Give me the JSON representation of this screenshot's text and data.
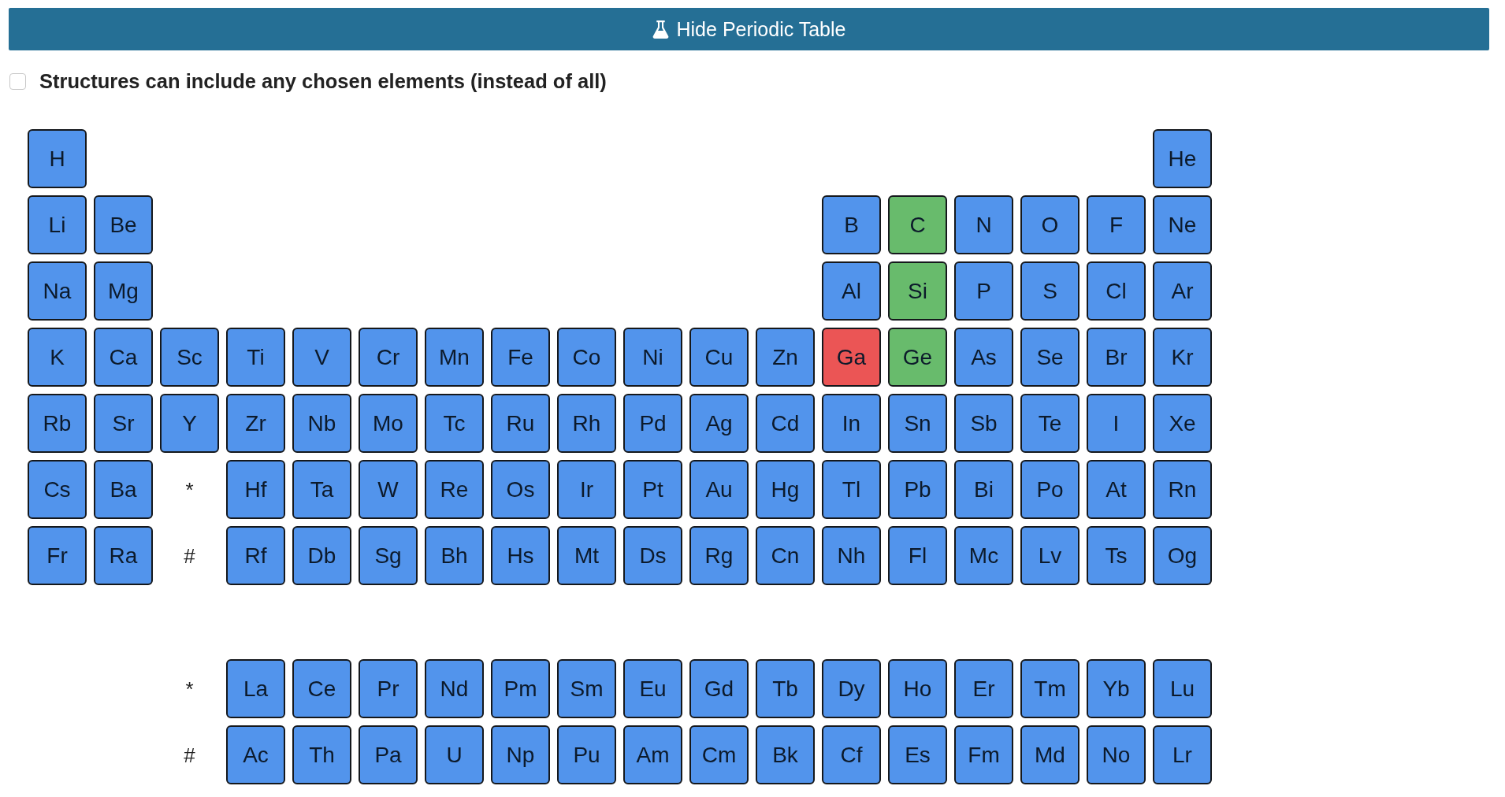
{
  "toggle_button": {
    "label": "Hide Periodic Table"
  },
  "option": {
    "label": "Structures can include any chosen elements (instead of all)",
    "checked": false
  },
  "periodic_table": {
    "main_rows": [
      {
        "cells": [
          {
            "kind": "element",
            "symbol": "H",
            "color": "#5294ec"
          },
          {
            "kind": "blank"
          },
          {
            "kind": "blank"
          },
          {
            "kind": "blank"
          },
          {
            "kind": "blank"
          },
          {
            "kind": "blank"
          },
          {
            "kind": "blank"
          },
          {
            "kind": "blank"
          },
          {
            "kind": "blank"
          },
          {
            "kind": "blank"
          },
          {
            "kind": "blank"
          },
          {
            "kind": "blank"
          },
          {
            "kind": "blank"
          },
          {
            "kind": "blank"
          },
          {
            "kind": "blank"
          },
          {
            "kind": "blank"
          },
          {
            "kind": "blank"
          },
          {
            "kind": "element",
            "symbol": "He",
            "color": "#5294ec"
          }
        ]
      },
      {
        "cells": [
          {
            "kind": "element",
            "symbol": "Li",
            "color": "#5294ec"
          },
          {
            "kind": "element",
            "symbol": "Be",
            "color": "#5294ec"
          },
          {
            "kind": "blank"
          },
          {
            "kind": "blank"
          },
          {
            "kind": "blank"
          },
          {
            "kind": "blank"
          },
          {
            "kind": "blank"
          },
          {
            "kind": "blank"
          },
          {
            "kind": "blank"
          },
          {
            "kind": "blank"
          },
          {
            "kind": "blank"
          },
          {
            "kind": "blank"
          },
          {
            "kind": "element",
            "symbol": "B",
            "color": "#5294ec"
          },
          {
            "kind": "element",
            "symbol": "C",
            "color": "#68bb6c"
          },
          {
            "kind": "element",
            "symbol": "N",
            "color": "#5294ec"
          },
          {
            "kind": "element",
            "symbol": "O",
            "color": "#5294ec"
          },
          {
            "kind": "element",
            "symbol": "F",
            "color": "#5294ec"
          },
          {
            "kind": "element",
            "symbol": "Ne",
            "color": "#5294ec"
          }
        ]
      },
      {
        "cells": [
          {
            "kind": "element",
            "symbol": "Na",
            "color": "#5294ec"
          },
          {
            "kind": "element",
            "symbol": "Mg",
            "color": "#5294ec"
          },
          {
            "kind": "blank"
          },
          {
            "kind": "blank"
          },
          {
            "kind": "blank"
          },
          {
            "kind": "blank"
          },
          {
            "kind": "blank"
          },
          {
            "kind": "blank"
          },
          {
            "kind": "blank"
          },
          {
            "kind": "blank"
          },
          {
            "kind": "blank"
          },
          {
            "kind": "blank"
          },
          {
            "kind": "element",
            "symbol": "Al",
            "color": "#5294ec"
          },
          {
            "kind": "element",
            "symbol": "Si",
            "color": "#68bb6c"
          },
          {
            "kind": "element",
            "symbol": "P",
            "color": "#5294ec"
          },
          {
            "kind": "element",
            "symbol": "S",
            "color": "#5294ec"
          },
          {
            "kind": "element",
            "symbol": "Cl",
            "color": "#5294ec"
          },
          {
            "kind": "element",
            "symbol": "Ar",
            "color": "#5294ec"
          }
        ]
      },
      {
        "cells": [
          {
            "kind": "element",
            "symbol": "K",
            "color": "#5294ec"
          },
          {
            "kind": "element",
            "symbol": "Ca",
            "color": "#5294ec"
          },
          {
            "kind": "element",
            "symbol": "Sc",
            "color": "#5294ec"
          },
          {
            "kind": "element",
            "symbol": "Ti",
            "color": "#5294ec"
          },
          {
            "kind": "element",
            "symbol": "V",
            "color": "#5294ec"
          },
          {
            "kind": "element",
            "symbol": "Cr",
            "color": "#5294ec"
          },
          {
            "kind": "element",
            "symbol": "Mn",
            "color": "#5294ec"
          },
          {
            "kind": "element",
            "symbol": "Fe",
            "color": "#5294ec"
          },
          {
            "kind": "element",
            "symbol": "Co",
            "color": "#5294ec"
          },
          {
            "kind": "element",
            "symbol": "Ni",
            "color": "#5294ec"
          },
          {
            "kind": "element",
            "symbol": "Cu",
            "color": "#5294ec"
          },
          {
            "kind": "element",
            "symbol": "Zn",
            "color": "#5294ec"
          },
          {
            "kind": "element",
            "symbol": "Ga",
            "color": "#eb5555"
          },
          {
            "kind": "element",
            "symbol": "Ge",
            "color": "#68bb6c"
          },
          {
            "kind": "element",
            "symbol": "As",
            "color": "#5294ec"
          },
          {
            "kind": "element",
            "symbol": "Se",
            "color": "#5294ec"
          },
          {
            "kind": "element",
            "symbol": "Br",
            "color": "#5294ec"
          },
          {
            "kind": "element",
            "symbol": "Kr",
            "color": "#5294ec"
          }
        ]
      },
      {
        "cells": [
          {
            "kind": "element",
            "symbol": "Rb",
            "color": "#5294ec"
          },
          {
            "kind": "element",
            "symbol": "Sr",
            "color": "#5294ec"
          },
          {
            "kind": "element",
            "symbol": "Y",
            "color": "#5294ec"
          },
          {
            "kind": "element",
            "symbol": "Zr",
            "color": "#5294ec"
          },
          {
            "kind": "element",
            "symbol": "Nb",
            "color": "#5294ec"
          },
          {
            "kind": "element",
            "symbol": "Mo",
            "color": "#5294ec"
          },
          {
            "kind": "element",
            "symbol": "Tc",
            "color": "#5294ec"
          },
          {
            "kind": "element",
            "symbol": "Ru",
            "color": "#5294ec"
          },
          {
            "kind": "element",
            "symbol": "Rh",
            "color": "#5294ec"
          },
          {
            "kind": "element",
            "symbol": "Pd",
            "color": "#5294ec"
          },
          {
            "kind": "element",
            "symbol": "Ag",
            "color": "#5294ec"
          },
          {
            "kind": "element",
            "symbol": "Cd",
            "color": "#5294ec"
          },
          {
            "kind": "element",
            "symbol": "In",
            "color": "#5294ec"
          },
          {
            "kind": "element",
            "symbol": "Sn",
            "color": "#5294ec"
          },
          {
            "kind": "element",
            "symbol": "Sb",
            "color": "#5294ec"
          },
          {
            "kind": "element",
            "symbol": "Te",
            "color": "#5294ec"
          },
          {
            "kind": "element",
            "symbol": "I",
            "color": "#5294ec"
          },
          {
            "kind": "element",
            "symbol": "Xe",
            "color": "#5294ec"
          }
        ]
      },
      {
        "cells": [
          {
            "kind": "element",
            "symbol": "Cs",
            "color": "#5294ec"
          },
          {
            "kind": "element",
            "symbol": "Ba",
            "color": "#5294ec"
          },
          {
            "kind": "marker",
            "text": "*"
          },
          {
            "kind": "element",
            "symbol": "Hf",
            "color": "#5294ec"
          },
          {
            "kind": "element",
            "symbol": "Ta",
            "color": "#5294ec"
          },
          {
            "kind": "element",
            "symbol": "W",
            "color": "#5294ec"
          },
          {
            "kind": "element",
            "symbol": "Re",
            "color": "#5294ec"
          },
          {
            "kind": "element",
            "symbol": "Os",
            "color": "#5294ec"
          },
          {
            "kind": "element",
            "symbol": "Ir",
            "color": "#5294ec"
          },
          {
            "kind": "element",
            "symbol": "Pt",
            "color": "#5294ec"
          },
          {
            "kind": "element",
            "symbol": "Au",
            "color": "#5294ec"
          },
          {
            "kind": "element",
            "symbol": "Hg",
            "color": "#5294ec"
          },
          {
            "kind": "element",
            "symbol": "Tl",
            "color": "#5294ec"
          },
          {
            "kind": "element",
            "symbol": "Pb",
            "color": "#5294ec"
          },
          {
            "kind": "element",
            "symbol": "Bi",
            "color": "#5294ec"
          },
          {
            "kind": "element",
            "symbol": "Po",
            "color": "#5294ec"
          },
          {
            "kind": "element",
            "symbol": "At",
            "color": "#5294ec"
          },
          {
            "kind": "element",
            "symbol": "Rn",
            "color": "#5294ec"
          }
        ]
      },
      {
        "cells": [
          {
            "kind": "element",
            "symbol": "Fr",
            "color": "#5294ec"
          },
          {
            "kind": "element",
            "symbol": "Ra",
            "color": "#5294ec"
          },
          {
            "kind": "marker",
            "text": "#"
          },
          {
            "kind": "element",
            "symbol": "Rf",
            "color": "#5294ec"
          },
          {
            "kind": "element",
            "symbol": "Db",
            "color": "#5294ec"
          },
          {
            "kind": "element",
            "symbol": "Sg",
            "color": "#5294ec"
          },
          {
            "kind": "element",
            "symbol": "Bh",
            "color": "#5294ec"
          },
          {
            "kind": "element",
            "symbol": "Hs",
            "color": "#5294ec"
          },
          {
            "kind": "element",
            "symbol": "Mt",
            "color": "#5294ec"
          },
          {
            "kind": "element",
            "symbol": "Ds",
            "color": "#5294ec"
          },
          {
            "kind": "element",
            "symbol": "Rg",
            "color": "#5294ec"
          },
          {
            "kind": "element",
            "symbol": "Cn",
            "color": "#5294ec"
          },
          {
            "kind": "element",
            "symbol": "Nh",
            "color": "#5294ec"
          },
          {
            "kind": "element",
            "symbol": "Fl",
            "color": "#5294ec"
          },
          {
            "kind": "element",
            "symbol": "Mc",
            "color": "#5294ec"
          },
          {
            "kind": "element",
            "symbol": "Lv",
            "color": "#5294ec"
          },
          {
            "kind": "element",
            "symbol": "Ts",
            "color": "#5294ec"
          },
          {
            "kind": "element",
            "symbol": "Og",
            "color": "#5294ec"
          }
        ]
      }
    ],
    "series_rows": [
      {
        "cells": [
          {
            "kind": "blank"
          },
          {
            "kind": "blank"
          },
          {
            "kind": "marker",
            "text": "*"
          },
          {
            "kind": "element",
            "symbol": "La",
            "color": "#5294ec"
          },
          {
            "kind": "element",
            "symbol": "Ce",
            "color": "#5294ec"
          },
          {
            "kind": "element",
            "symbol": "Pr",
            "color": "#5294ec"
          },
          {
            "kind": "element",
            "symbol": "Nd",
            "color": "#5294ec"
          },
          {
            "kind": "element",
            "symbol": "Pm",
            "color": "#5294ec"
          },
          {
            "kind": "element",
            "symbol": "Sm",
            "color": "#5294ec"
          },
          {
            "kind": "element",
            "symbol": "Eu",
            "color": "#5294ec"
          },
          {
            "kind": "element",
            "symbol": "Gd",
            "color": "#5294ec"
          },
          {
            "kind": "element",
            "symbol": "Tb",
            "color": "#5294ec"
          },
          {
            "kind": "element",
            "symbol": "Dy",
            "color": "#5294ec"
          },
          {
            "kind": "element",
            "symbol": "Ho",
            "color": "#5294ec"
          },
          {
            "kind": "element",
            "symbol": "Er",
            "color": "#5294ec"
          },
          {
            "kind": "element",
            "symbol": "Tm",
            "color": "#5294ec"
          },
          {
            "kind": "element",
            "symbol": "Yb",
            "color": "#5294ec"
          },
          {
            "kind": "element",
            "symbol": "Lu",
            "color": "#5294ec"
          }
        ]
      },
      {
        "cells": [
          {
            "kind": "blank"
          },
          {
            "kind": "blank"
          },
          {
            "kind": "marker",
            "text": "#"
          },
          {
            "kind": "element",
            "symbol": "Ac",
            "color": "#5294ec"
          },
          {
            "kind": "element",
            "symbol": "Th",
            "color": "#5294ec"
          },
          {
            "kind": "element",
            "symbol": "Pa",
            "color": "#5294ec"
          },
          {
            "kind": "element",
            "symbol": "U",
            "color": "#5294ec"
          },
          {
            "kind": "element",
            "symbol": "Np",
            "color": "#5294ec"
          },
          {
            "kind": "element",
            "symbol": "Pu",
            "color": "#5294ec"
          },
          {
            "kind": "element",
            "symbol": "Am",
            "color": "#5294ec"
          },
          {
            "kind": "element",
            "symbol": "Cm",
            "color": "#5294ec"
          },
          {
            "kind": "element",
            "symbol": "Bk",
            "color": "#5294ec"
          },
          {
            "kind": "element",
            "symbol": "Cf",
            "color": "#5294ec"
          },
          {
            "kind": "element",
            "symbol": "Es",
            "color": "#5294ec"
          },
          {
            "kind": "element",
            "symbol": "Fm",
            "color": "#5294ec"
          },
          {
            "kind": "element",
            "symbol": "Md",
            "color": "#5294ec"
          },
          {
            "kind": "element",
            "symbol": "No",
            "color": "#5294ec"
          },
          {
            "kind": "element",
            "symbol": "Lr",
            "color": "#5294ec"
          }
        ]
      }
    ]
  }
}
